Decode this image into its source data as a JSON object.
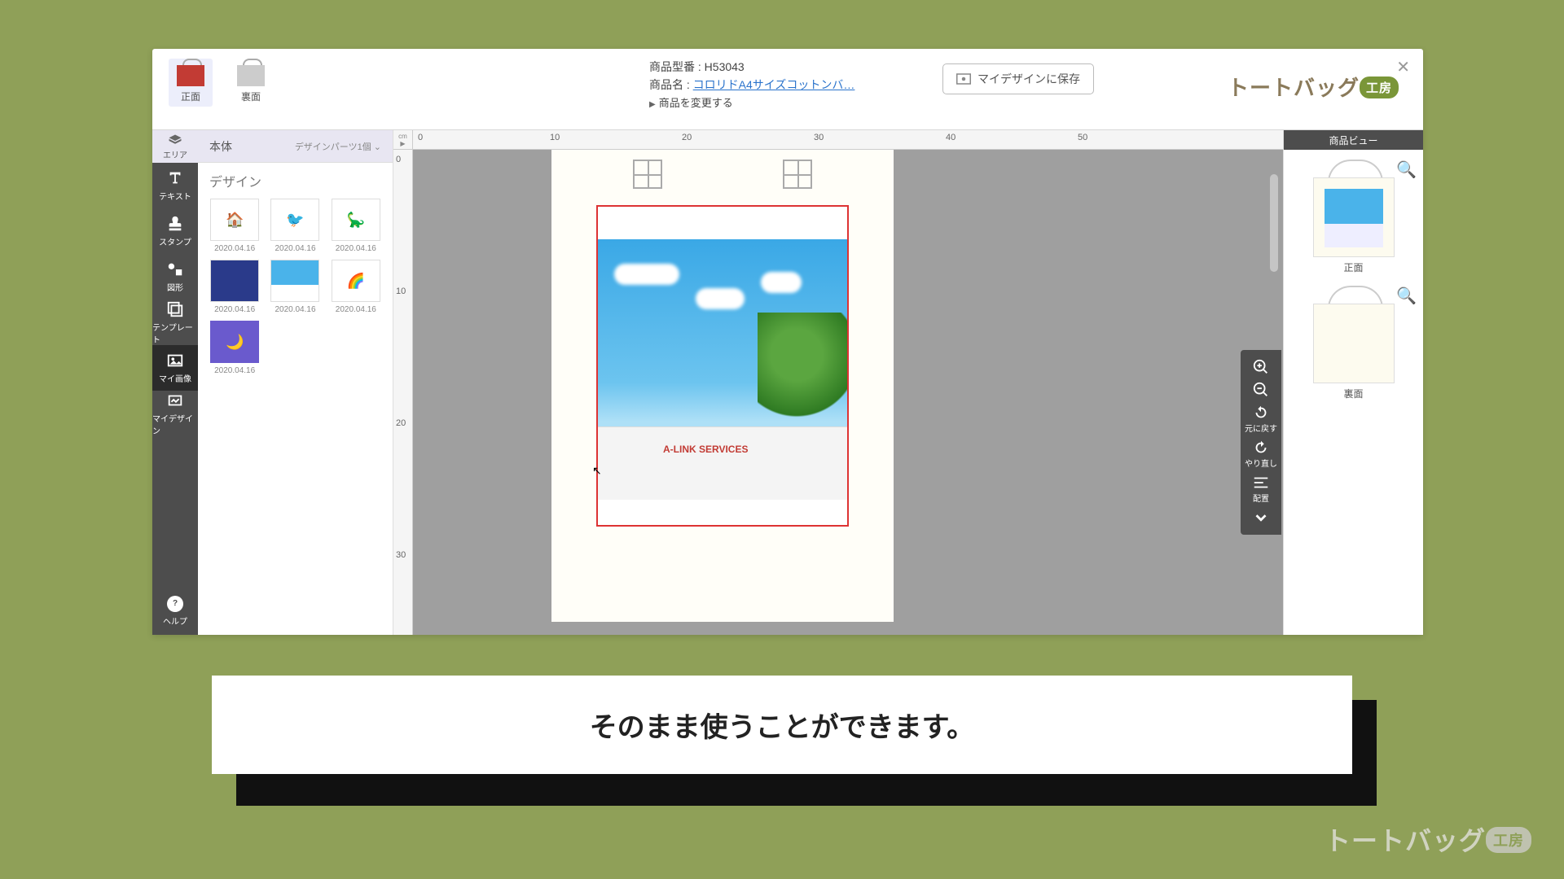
{
  "header": {
    "front": "正面",
    "back": "裏面",
    "model_label": "商品型番 : ",
    "model": "H53043",
    "name_label": "商品名 : ",
    "name": "コロリドA4サイズコットンバ…",
    "change": "商品を変更する",
    "save": "マイデザインに保存",
    "brand_a": "トートバッグ",
    "brand_b": "工房"
  },
  "rail": {
    "area": "エリア",
    "text": "テキスト",
    "stamp": "スタンプ",
    "shape": "図形",
    "template": "テンプレート",
    "myimg": "マイ画像",
    "mydesign": "マイデザイン",
    "help": "ヘルプ"
  },
  "panel": {
    "body": "本体",
    "parts": "デザインパーツ1個",
    "design": "デザイン"
  },
  "dates": [
    "2020.04.16",
    "2020.04.16",
    "2020.04.16",
    "2020.04.16",
    "2020.04.16",
    "2020.04.16",
    "2020.04.16"
  ],
  "ruler": {
    "unit": "cm",
    "h": [
      "0",
      "10",
      "20",
      "30",
      "40",
      "50"
    ],
    "v": [
      "0",
      "10",
      "20",
      "30"
    ]
  },
  "building": "A-LINK SERVICES",
  "tools": {
    "undo": "元に戻す",
    "redo": "やり直し",
    "align": "配置"
  },
  "preview": {
    "title": "商品ビュー",
    "front": "正面",
    "back": "裏面"
  },
  "caption": "そのまま使うことができます。",
  "wm_a": "トートバッグ",
  "wm_b": "工房"
}
